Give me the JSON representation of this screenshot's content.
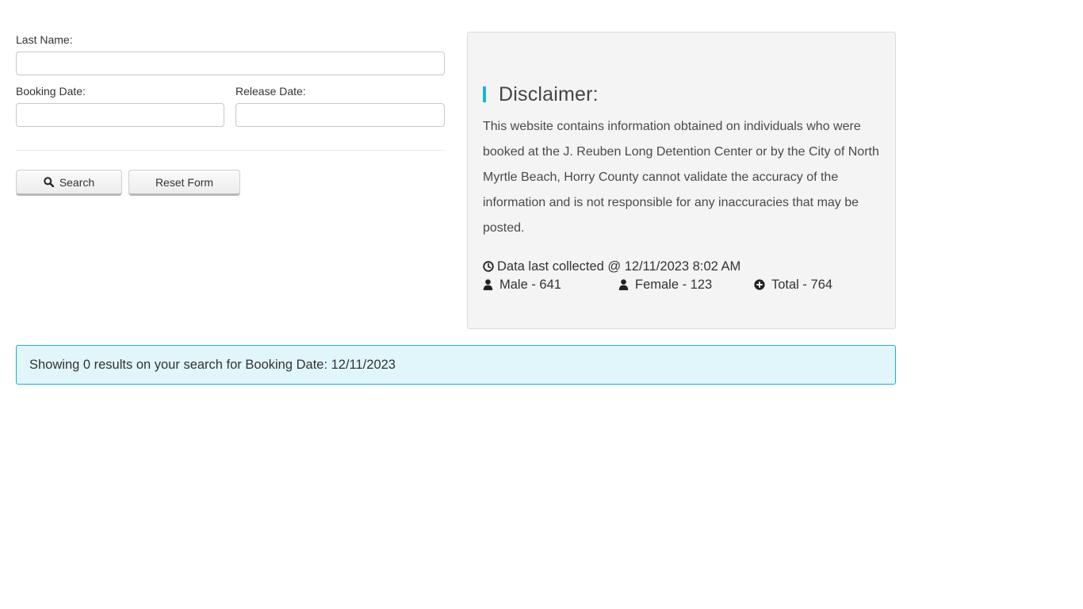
{
  "form": {
    "last_name_label": "Last Name:",
    "last_name_value": "",
    "booking_date_label": "Booking Date:",
    "booking_date_value": "",
    "release_date_label": "Release Date:",
    "release_date_value": "",
    "search_label": "Search",
    "reset_label": "Reset Form",
    "search_icon": "search-icon"
  },
  "disclaimer": {
    "title": "Disclaimer:",
    "body": "This website contains information obtained on individuals who were booked at the J. Reuben Long Detention Center or by the City of North Myrtle Beach, Horry County cannot validate the accuracy of the information and is not responsible for any inaccuracies that may be posted.",
    "last_collected": "Data last collected @ 12/11/2023 8:02 AM",
    "clock_icon": "clock-icon",
    "stats": {
      "male": "Male - 641",
      "female": "Female - 123",
      "total": "Total - 764"
    },
    "accent_color": "#19b5d3"
  },
  "results": {
    "message": "Showing 0 results on your search for Booking Date: 12/11/2023",
    "border_color": "#1ab0c8",
    "background_color": "#e1f6fb"
  }
}
